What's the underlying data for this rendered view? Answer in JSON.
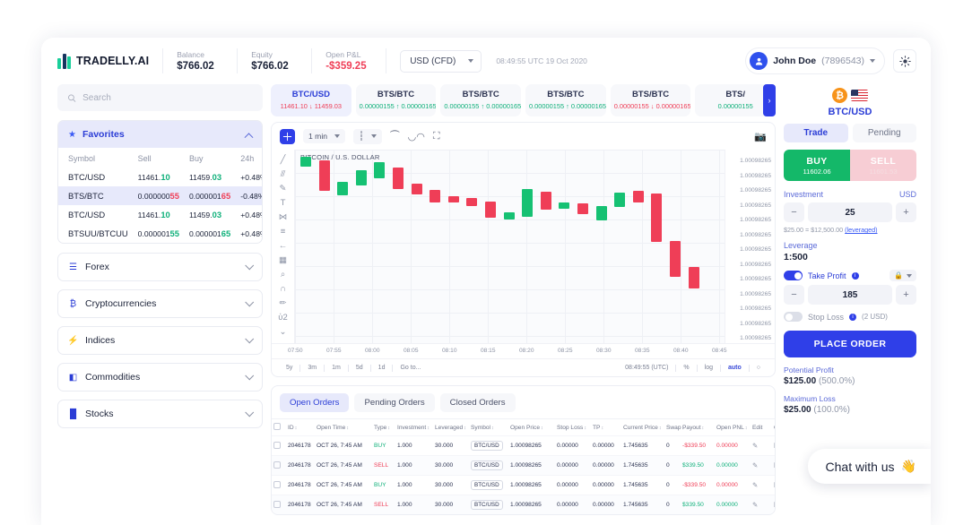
{
  "header": {
    "brand": "TRADELLY.AI",
    "stats": [
      {
        "label": "Balance",
        "value": "$766.02",
        "negative": false
      },
      {
        "label": "Equity",
        "value": "$766.02",
        "negative": false
      },
      {
        "label": "Open P&L",
        "value": "-$359.25",
        "negative": true
      }
    ],
    "currency_select": "USD (CFD)",
    "clock": "08:49:55 UTC 19 Oct 2020",
    "user_name": "John Doe",
    "user_id": "(7896543)",
    "theme_icon": "sun-icon",
    "user_caret_icon": "chevron-down-icon"
  },
  "sidebar": {
    "search_placeholder": "Search",
    "search_value": "",
    "search_icon": "search-icon",
    "favorites": {
      "title": "Favorites",
      "star_icon": "star-icon",
      "collapse_icon": "chevron-up-icon",
      "columns": [
        "Symbol",
        "Sell",
        "Buy",
        "24h"
      ],
      "rows": [
        {
          "symbol": "BTC/USD",
          "sell_small": "11461.",
          "sell_big": "10",
          "buy_small": "11459.",
          "buy_big": "03",
          "change": "+0.48%",
          "dir": "up",
          "selected": false
        },
        {
          "symbol": "BTS/BTC",
          "sell_small": "0.000000",
          "sell_big": "55",
          "buy_small": "0.000001",
          "buy_big": "65",
          "change": "-0.48%",
          "dir": "down",
          "selected": true
        },
        {
          "symbol": "BTC/USD",
          "sell_small": "11461.",
          "sell_big": "10",
          "buy_small": "11459.",
          "buy_big": "03",
          "change": "+0.48%",
          "dir": "up",
          "selected": false
        },
        {
          "symbol": "BTSUU/BTCUU",
          "sell_small": "0.000001",
          "sell_big": "55",
          "buy_small": "0.000001",
          "buy_big": "65",
          "change": "+0.48%",
          "dir": "up",
          "selected": false
        }
      ]
    },
    "categories": [
      {
        "label": "Forex",
        "icon": "database-icon",
        "glyph": "☰"
      },
      {
        "label": "Cryptocurrencies",
        "icon": "bitcoin-icon",
        "glyph": "₿"
      },
      {
        "label": "Indices",
        "icon": "bolt-icon",
        "glyph": "⚡"
      },
      {
        "label": "Commodities",
        "icon": "oil-barrel-icon",
        "glyph": "◧"
      },
      {
        "label": "Stocks",
        "icon": "bar-chart-icon",
        "glyph": "█"
      }
    ]
  },
  "instrument_tabs": [
    {
      "name": "BTC/USD",
      "sell": "11461.10",
      "buy": "11459.03",
      "arrow": "↓",
      "dir": "down",
      "active": true
    },
    {
      "name": "BTS/BTC",
      "sell": "0.00000155",
      "buy": "0.00000165",
      "arrow": "↑",
      "dir": "up",
      "active": false
    },
    {
      "name": "BTS/BTC",
      "sell": "0.00000155",
      "buy": "0.00000165",
      "arrow": "↑",
      "dir": "up",
      "active": false
    },
    {
      "name": "BTS/BTC",
      "sell": "0.00000155",
      "buy": "0.00000165",
      "arrow": "↑",
      "dir": "up",
      "active": false
    },
    {
      "name": "BTS/BTC",
      "sell": "0.00000155",
      "buy": "0.00000165",
      "arrow": "↓",
      "dir": "down",
      "active": false
    },
    {
      "name": "BTS/",
      "sell": "0.00000155",
      "buy": "",
      "arrow": "",
      "dir": "up",
      "active": false
    }
  ],
  "tab_next_icon": "chevron-right-icon",
  "chart": {
    "toolbar": {
      "crosshair_icon": "crosshair-icon",
      "interval": "1 min",
      "interval_caret": "chevron-down-icon",
      "candle_type_icon": "candlestick-icon",
      "candle_caret": "chevron-down-icon",
      "indicator_icon": "indicators-icon",
      "compare_icon": "compare-icon",
      "fullscreen_icon": "fullscreen-icon",
      "camera_icon": "camera-icon"
    },
    "draw_tools": [
      "trendline-icon",
      "parallel-channel-icon",
      "brush-icon",
      "text-icon",
      "fib-icon",
      "measure-icon",
      "arrow-left-icon",
      "pattern-icon",
      "zoom-icon",
      "magnet-icon",
      "eraser-icon",
      "lock-icon",
      "more-icon"
    ],
    "title": "BITCOIN / U.S. DOLLAR",
    "price_labels": [
      "1.00098265",
      "1.00098265",
      "1.00098265",
      "1.00098265",
      "1.00098265",
      "1.00098265",
      "1.00098265",
      "1.00098265",
      "1.00098265",
      "1.00098265",
      "1.00098265",
      "1.00098265",
      "1.00098265"
    ],
    "time_labels": [
      "07:50",
      "07:55",
      "08:00",
      "08:05",
      "08:10",
      "08:15",
      "08:20",
      "08:25",
      "08:30",
      "08:35",
      "08:40",
      "08:45"
    ],
    "footer_left": [
      "5y",
      "3m",
      "1m",
      "5d",
      "1d",
      "Go to..."
    ],
    "footer_right": [
      "08:49:55 (UTC)",
      "%",
      "log",
      "auto",
      "○"
    ],
    "footer_bold": "auto"
  },
  "chart_data": {
    "type": "candlestick",
    "title": "BITCOIN / U.S. DOLLAR",
    "interval": "1 min",
    "xlabel": "",
    "ylabel": "",
    "x": [
      "07:50",
      "07:55",
      "08:00",
      "08:05",
      "08:10",
      "08:15",
      "08:20",
      "08:25",
      "08:30",
      "08:35",
      "08:40",
      "08:45"
    ],
    "ylim": [
      1.00098265,
      1.00098265
    ],
    "grid": true,
    "legend": "none",
    "candles": [
      {
        "i": 0,
        "top": 8,
        "height": 11,
        "dir": "up"
      },
      {
        "i": 1,
        "top": 12,
        "height": 34,
        "dir": "down"
      },
      {
        "i": 2,
        "top": 36,
        "height": 15,
        "dir": "up"
      },
      {
        "i": 3,
        "top": 23,
        "height": 17,
        "dir": "up"
      },
      {
        "i": 4,
        "top": 14,
        "height": 18,
        "dir": "up"
      },
      {
        "i": 5,
        "top": 20,
        "height": 24,
        "dir": "down"
      },
      {
        "i": 6,
        "top": 38,
        "height": 12,
        "dir": "down"
      },
      {
        "i": 7,
        "top": 45,
        "height": 14,
        "dir": "down"
      },
      {
        "i": 8,
        "top": 52,
        "height": 7,
        "dir": "down"
      },
      {
        "i": 9,
        "top": 54,
        "height": 9,
        "dir": "down"
      },
      {
        "i": 10,
        "top": 58,
        "height": 18,
        "dir": "down"
      },
      {
        "i": 11,
        "top": 70,
        "height": 8,
        "dir": "up"
      },
      {
        "i": 12,
        "top": 44,
        "height": 31,
        "dir": "up"
      },
      {
        "i": 13,
        "top": 47,
        "height": 20,
        "dir": "down"
      },
      {
        "i": 14,
        "top": 59,
        "height": 7,
        "dir": "up"
      },
      {
        "i": 15,
        "top": 60,
        "height": 12,
        "dir": "down"
      },
      {
        "i": 16,
        "top": 63,
        "height": 16,
        "dir": "up"
      },
      {
        "i": 17,
        "top": 48,
        "height": 16,
        "dir": "up"
      },
      {
        "i": 18,
        "top": 46,
        "height": 13,
        "dir": "down"
      },
      {
        "i": 19,
        "top": 49,
        "height": 54,
        "dir": "down"
      },
      {
        "i": 20,
        "top": 102,
        "height": 40,
        "dir": "down"
      },
      {
        "i": 21,
        "top": 131,
        "height": 24,
        "dir": "down"
      }
    ],
    "colors": {
      "up": "#16c173",
      "down": "#ef3e57"
    }
  },
  "orders": {
    "tabs": [
      {
        "label": "Open Orders",
        "active": true
      },
      {
        "label": "Pending Orders",
        "active": false
      },
      {
        "label": "Closed Orders",
        "active": false
      }
    ],
    "columns": [
      "ID",
      "Open Time",
      "Type",
      "Investment",
      "Leveraged",
      "Symbol",
      "Open Price",
      "Stop Loss",
      "TP",
      "Current Price",
      "Swap",
      "Payout",
      "Open PNL",
      "Edit",
      "Close"
    ],
    "rows": [
      {
        "id": "2046178",
        "open_time": "OCT 26, 7:45 AM",
        "type": "BUY",
        "investment": "1.000",
        "leveraged": "30.000",
        "symbol": "BTC/USD",
        "open_price": "1.00098265",
        "stop_loss": "0.00000",
        "tp": "0.00000",
        "current_price": "1.745635",
        "swap": "0",
        "payout": "-$339.50",
        "open_pnl": "0.00000",
        "dir": "down"
      },
      {
        "id": "2046178",
        "open_time": "OCT 26, 7:45 AM",
        "type": "SELL",
        "investment": "1.000",
        "leveraged": "30.000",
        "symbol": "BTC/USD",
        "open_price": "1.00098265",
        "stop_loss": "0.00000",
        "tp": "0.00000",
        "current_price": "1.745635",
        "swap": "0",
        "payout": "$339.50",
        "open_pnl": "0.00000",
        "dir": "up"
      },
      {
        "id": "2046178",
        "open_time": "OCT 26, 7:45 AM",
        "type": "BUY",
        "investment": "1.000",
        "leveraged": "30.000",
        "symbol": "BTC/USD",
        "open_price": "1.00098265",
        "stop_loss": "0.00000",
        "tp": "0.00000",
        "current_price": "1.745635",
        "swap": "0",
        "payout": "-$339.50",
        "open_pnl": "0.00000",
        "dir": "down"
      },
      {
        "id": "2046178",
        "open_time": "OCT 26, 7:45 AM",
        "type": "SELL",
        "investment": "1.000",
        "leveraged": "30.000",
        "symbol": "BTC/USD",
        "open_price": "1.00098265",
        "stop_loss": "0.00000",
        "tp": "0.00000",
        "current_price": "1.745635",
        "swap": "0",
        "payout": "$339.50",
        "open_pnl": "0.00000",
        "dir": "up"
      }
    ],
    "edit_icon": "pencil-icon",
    "close_icon": "close-circle-icon"
  },
  "trade_panel": {
    "coin_icon": "bitcoin-icon",
    "flag_icon": "us-flag-icon",
    "pair": "BTC/USD",
    "segments": [
      {
        "label": "Trade",
        "active": true
      },
      {
        "label": "Pending",
        "active": false
      }
    ],
    "buy": {
      "label": "BUY",
      "price": "11602.06"
    },
    "sell": {
      "label": "SELL",
      "price": "11601.53"
    },
    "investment_label": "Investment",
    "investment_unit": "USD",
    "investment_value": "25",
    "minus_icon": "minus-icon",
    "plus_icon": "plus-icon",
    "investment_hint_plain": "$25.00 = $12,500.00 ",
    "investment_hint_link": "(leveraged)",
    "leverage_label": "Leverage",
    "leverage_value": "1:500",
    "take_profit_label": "Take Profit",
    "take_profit_value": "185",
    "take_profit_on": true,
    "lock_icon": "lock-icon",
    "lock_caret_icon": "chevron-down-icon",
    "info_icon": "info-icon",
    "stop_loss_label": "Stop Loss",
    "stop_loss_note": "(2 USD)",
    "stop_loss_on": false,
    "place_order_label": "PLACE ORDER",
    "potential_profit_label": "Potential Profit",
    "potential_profit_value": "$125.00",
    "potential_profit_pct": "(500.0%)",
    "maximum_loss_label": "Maximum Loss",
    "maximum_loss_value": "$25.00",
    "maximum_loss_pct": "(100.0%)"
  },
  "chat": {
    "label": "Chat with us",
    "icon": "wave-hand-icon",
    "glyph": "👋"
  },
  "colors": {
    "accent": "#2f3fe8",
    "up": "#0fb07a",
    "down": "#ef3e57",
    "brand": "#19cf9a"
  }
}
